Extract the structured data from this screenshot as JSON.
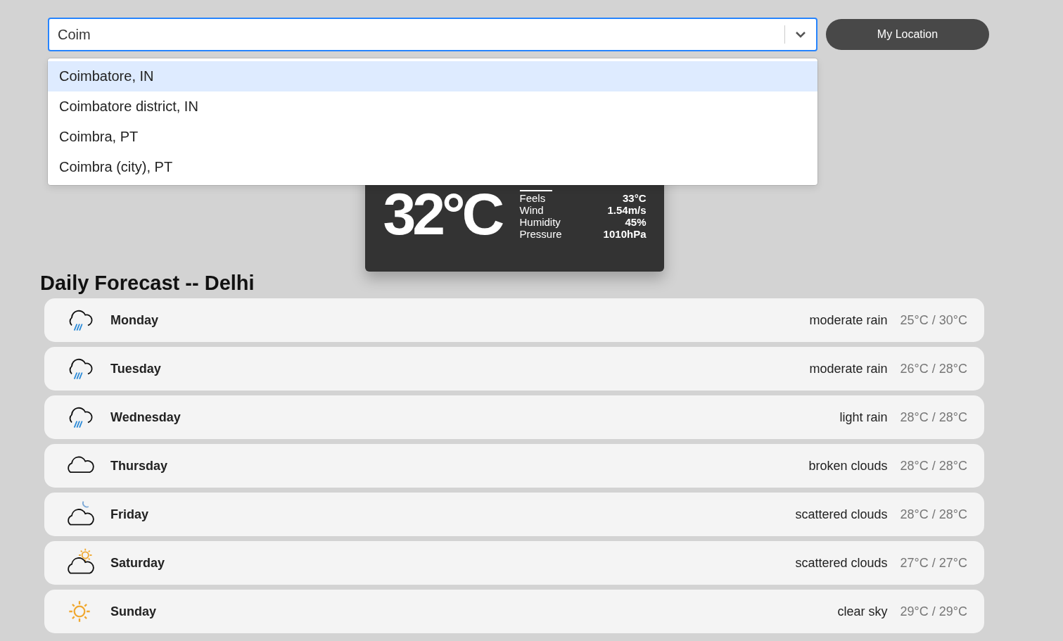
{
  "search": {
    "value": "Coim"
  },
  "location_button": "My Location",
  "suggestions": [
    {
      "label": "Coimbatore, IN",
      "selected": true
    },
    {
      "label": "Coimbatore district, IN",
      "selected": false
    },
    {
      "label": "Coimbra, PT",
      "selected": false
    },
    {
      "label": "Coimbra (city), PT",
      "selected": false
    }
  ],
  "current": {
    "temperature": "32°C",
    "details": [
      {
        "label": "Feels",
        "value": "33°C"
      },
      {
        "label": "Wind",
        "value": "1.54m/s"
      },
      {
        "label": "Humidity",
        "value": "45%"
      },
      {
        "label": "Pressure",
        "value": "1010hPa"
      }
    ]
  },
  "forecast_title": "Daily Forecast -- Delhi",
  "forecast": [
    {
      "day": "Monday",
      "kind": "rain",
      "description": "moderate rain",
      "temps": "25°C / 30°C"
    },
    {
      "day": "Tuesday",
      "kind": "rain",
      "description": "moderate rain",
      "temps": "26°C / 28°C"
    },
    {
      "day": "Wednesday",
      "kind": "rain",
      "description": "light rain",
      "temps": "28°C / 28°C"
    },
    {
      "day": "Thursday",
      "kind": "cloud",
      "description": "broken clouds",
      "temps": "28°C / 28°C"
    },
    {
      "day": "Friday",
      "kind": "night-cloud",
      "description": "scattered clouds",
      "temps": "28°C / 28°C"
    },
    {
      "day": "Saturday",
      "kind": "day-cloud",
      "description": "scattered clouds",
      "temps": "27°C / 27°C"
    },
    {
      "day": "Sunday",
      "kind": "sun",
      "description": "clear sky",
      "temps": "29°C / 29°C"
    }
  ]
}
